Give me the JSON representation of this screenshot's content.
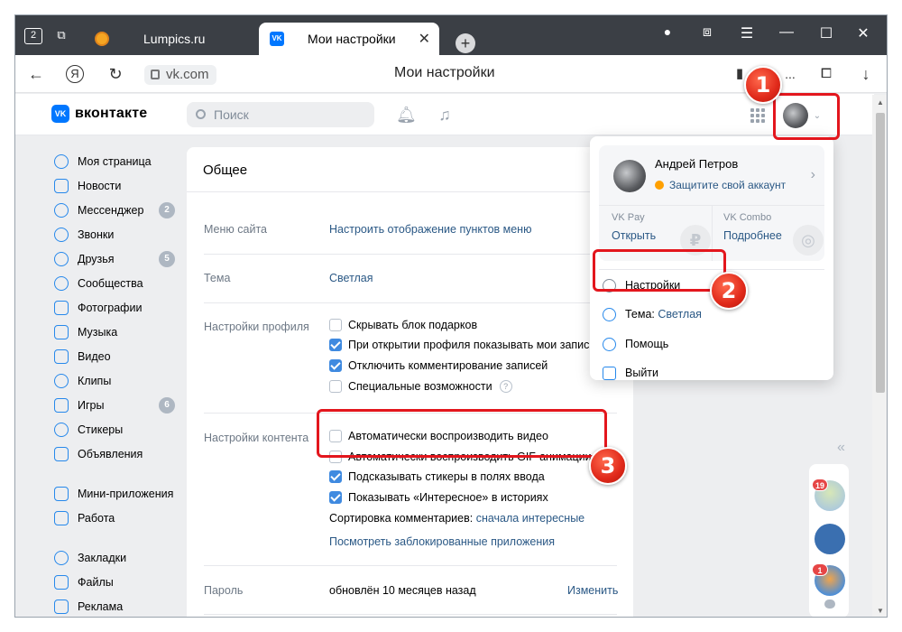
{
  "browser": {
    "tab_home_number": "2",
    "tab_inactive_label": "Lumpics.ru",
    "tab_active_label": "Мои настройки",
    "url": "vk.com",
    "page_title": "Мои настройки",
    "overflow_label": "..."
  },
  "header": {
    "logo_text": "вконтакте",
    "search_placeholder": "Поиск"
  },
  "sidebar": {
    "items": [
      {
        "label": "Моя страница",
        "badge": ""
      },
      {
        "label": "Новости",
        "badge": ""
      },
      {
        "label": "Мессенджер",
        "badge": "2"
      },
      {
        "label": "Звонки",
        "badge": ""
      },
      {
        "label": "Друзья",
        "badge": "5"
      },
      {
        "label": "Сообщества",
        "badge": ""
      },
      {
        "label": "Фотографии",
        "badge": ""
      },
      {
        "label": "Музыка",
        "badge": ""
      },
      {
        "label": "Видео",
        "badge": ""
      },
      {
        "label": "Клипы",
        "badge": ""
      },
      {
        "label": "Игры",
        "badge": "6"
      },
      {
        "label": "Стикеры",
        "badge": ""
      },
      {
        "label": "Объявления",
        "badge": ""
      },
      {
        "label": "Мини-приложения",
        "badge": ""
      },
      {
        "label": "Работа",
        "badge": ""
      },
      {
        "label": "Закладки",
        "badge": ""
      },
      {
        "label": "Файлы",
        "badge": ""
      },
      {
        "label": "Реклама",
        "badge": ""
      }
    ]
  },
  "settings": {
    "section_title": "Общее",
    "site_menu_label": "Меню сайта",
    "site_menu_link": "Настроить отображение пунктов меню",
    "theme_label": "Тема",
    "theme_value": "Светлая",
    "profile_label": "Настройки профиля",
    "profile_options": [
      {
        "label": "Скрывать блок подарков",
        "checked": false
      },
      {
        "label": "При открытии профиля показывать мои записи",
        "checked": true
      },
      {
        "label": "Отключить комментирование записей",
        "checked": true
      },
      {
        "label": "Специальные возможности",
        "checked": false
      }
    ],
    "help_glyph": "?",
    "content_label": "Настройки контента",
    "content_options": [
      {
        "label": "Автоматически воспроизводить видео",
        "checked": false
      },
      {
        "label": "Автоматически воспроизводить GIF-анимации",
        "checked": false
      },
      {
        "label": "Подсказывать стикеры в полях ввода",
        "checked": true
      },
      {
        "label": "Показывать «Интересное» в историях",
        "checked": true
      }
    ],
    "comments_sort_label": "Сортировка комментариев:",
    "comments_sort_value": "сначала интересные",
    "blocked_apps_link": "Посмотреть заблокированные приложения",
    "password_label": "Пароль",
    "password_value": "обновлён 10 месяцев назад",
    "password_change": "Изменить"
  },
  "dropdown": {
    "user_name": "Андрей Петров",
    "secure_account": "Защитите свой аккаунт",
    "vkpay_title": "VK Pay",
    "vkpay_link": "Открыть",
    "vkcombo_title": "VK Combo",
    "vkcombo_link": "Подробнее",
    "menu_settings": "Настройки",
    "menu_theme_prefix": "Тема:",
    "menu_theme_value": "Светлая",
    "menu_help": "Помощь",
    "menu_logout": "Выйти"
  },
  "annotations": {
    "step1": "1",
    "step2": "2",
    "step3": "3"
  },
  "chats": {
    "badge1": "19",
    "badge2": "1"
  },
  "colors": {
    "vk_blue": "#0077ff",
    "link": "#2a5885",
    "callout_red": "#e3161d"
  }
}
